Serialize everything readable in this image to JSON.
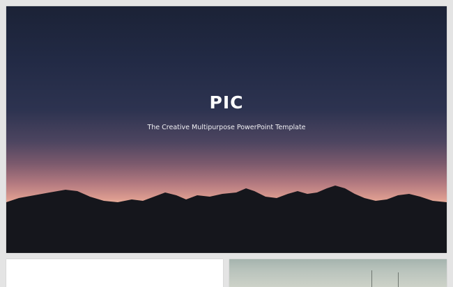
{
  "slide": {
    "title": "PIC",
    "subtitle": "The Creative Multipurpose PowerPoint Template"
  }
}
